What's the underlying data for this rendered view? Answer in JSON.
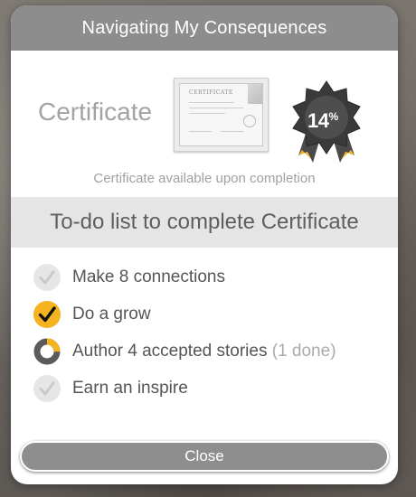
{
  "modal": {
    "title": "Navigating My Consequences",
    "certificate": {
      "label": "Certificate",
      "image_title": "CERTIFICATE",
      "progress": {
        "value": "14",
        "unit": "%"
      },
      "note": "Certificate available upon completion"
    },
    "todo": {
      "heading": "To-do list to complete Certificate",
      "items": [
        {
          "label": "Make 8 connections",
          "extra": "",
          "status": "incomplete",
          "icon": "check-circle-grey-icon"
        },
        {
          "label": "Do a grow",
          "extra": "",
          "status": "complete",
          "icon": "check-circle-yellow-icon"
        },
        {
          "label": "Author 4 accepted stories",
          "extra": "(1 done)",
          "status": "partial",
          "progress_fraction": 0.25,
          "icon": "progress-ring-icon"
        },
        {
          "label": "Earn an inspire",
          "extra": "",
          "status": "incomplete",
          "icon": "check-circle-grey-icon"
        }
      ]
    },
    "close_label": "Close"
  },
  "colors": {
    "header": "#8d8d8d",
    "accent_yellow": "#f5b31f",
    "badge_dark": "#333333",
    "button": "#8e8e8e"
  }
}
